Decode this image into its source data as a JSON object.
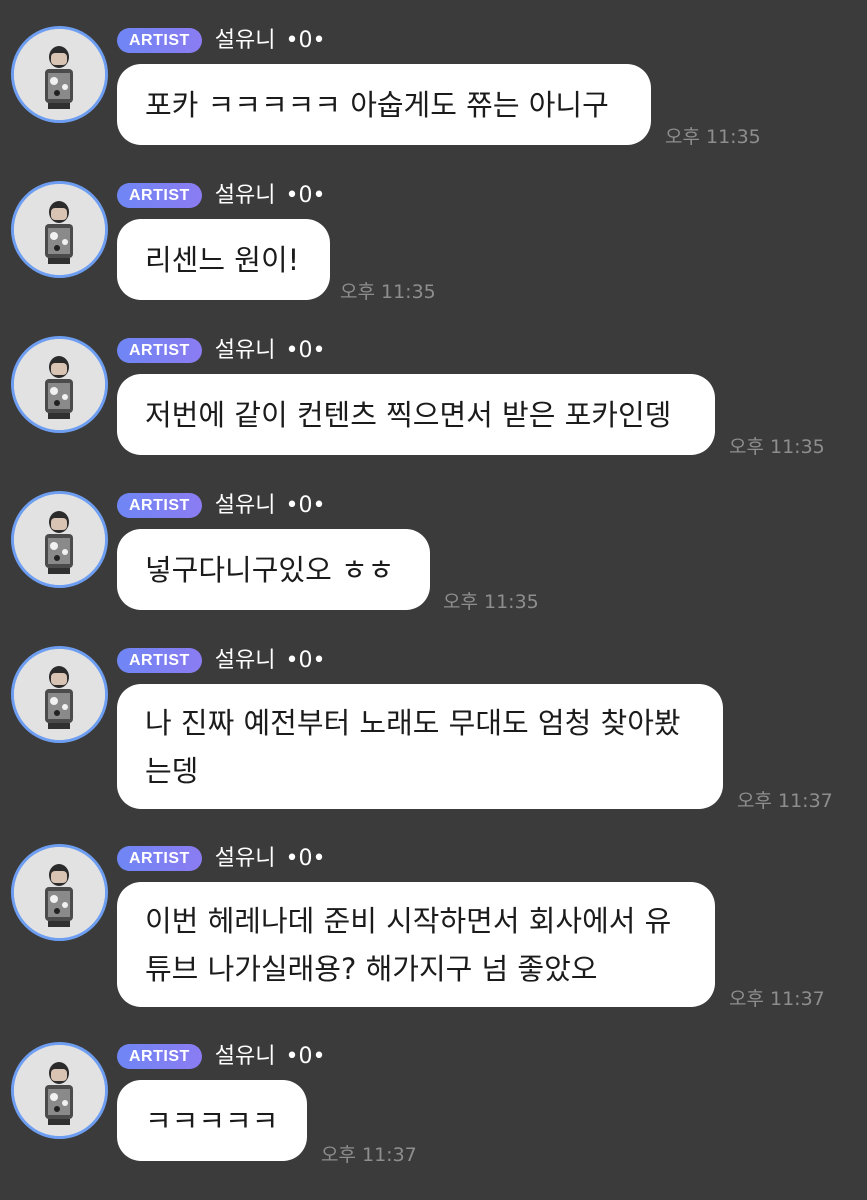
{
  "messages": [
    {
      "badge": "ARTIST",
      "sender": "설유니",
      "status": "•0•",
      "lines": [
        "포카 ㅋㅋㅋㅋㅋ 아숩게도 쮸는 아니구"
      ],
      "time": "오후 11:35"
    },
    {
      "badge": "ARTIST",
      "sender": "설유니",
      "status": "•0•",
      "lines": [
        "리센느 원이!"
      ],
      "time": "오후 11:35"
    },
    {
      "badge": "ARTIST",
      "sender": "설유니",
      "status": "•0•",
      "lines": [
        "저번에 같이 컨텐츠 찍으면서 받은 포카인뎅"
      ],
      "time": "오후 11:35"
    },
    {
      "badge": "ARTIST",
      "sender": "설유니",
      "status": "•0•",
      "lines": [
        "넣구다니구있오 ㅎㅎ"
      ],
      "time": "오후 11:35"
    },
    {
      "badge": "ARTIST",
      "sender": "설유니",
      "status": "•0•",
      "lines": [
        "나 진짜 예전부터 노래도 무대도 엄청 찾아봤",
        "는뎅"
      ],
      "time": "오후 11:37"
    },
    {
      "badge": "ARTIST",
      "sender": "설유니",
      "status": "•0•",
      "lines": [
        "이번 헤레나데 준비 시작하면서 회사에서 유",
        "튜브 나가실래용? 해가지구 넘 좋았오"
      ],
      "time": "오후 11:37"
    },
    {
      "badge": "ARTIST",
      "sender": "설유니",
      "status": "•0•",
      "lines": [
        "ㅋㅋㅋㅋㅋ"
      ],
      "time": "오후 11:37"
    }
  ]
}
